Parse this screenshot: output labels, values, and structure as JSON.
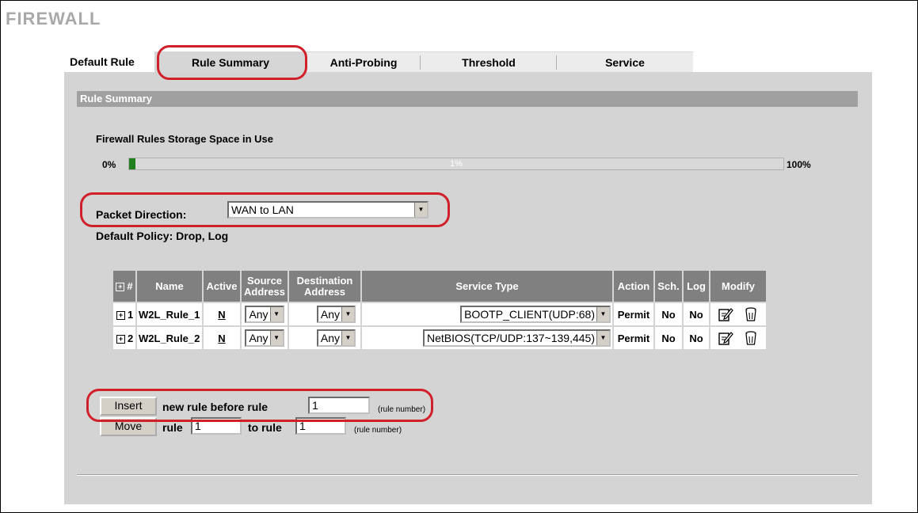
{
  "page": {
    "title": "FIREWALL"
  },
  "tabs": [
    {
      "label": "Default Rule"
    },
    {
      "label": "Rule Summary"
    },
    {
      "label": "Anti-Probing"
    },
    {
      "label": "Threshold"
    },
    {
      "label": "Service"
    }
  ],
  "active_tab": "Rule Summary",
  "section": {
    "title": "Rule Summary"
  },
  "storage": {
    "label": "Firewall Rules Storage Space in Use",
    "min_label": "0%",
    "max_label": "100%",
    "value_label": "1%",
    "fill_fraction": 0.01,
    "fill_color": "#208020"
  },
  "direction": {
    "label": "Packet Direction:",
    "value": "WAN to LAN"
  },
  "policy": {
    "text": "Default Policy: Drop, Log"
  },
  "table": {
    "headers": {
      "num": "#",
      "name": "Name",
      "active": "Active",
      "source_1": "Source",
      "source_2": "Address",
      "dest_1": "Destination",
      "dest_2": "Address",
      "service": "Service Type",
      "action": "Action",
      "sch": "Sch.",
      "log": "Log",
      "modify": "Modify"
    },
    "rows": [
      {
        "num": "1",
        "name": "W2L_Rule_1",
        "active": "N",
        "source": "Any",
        "dest": "Any",
        "service": "BOOTP_CLIENT(UDP:68)",
        "action": "Permit",
        "sch": "No",
        "log": "No"
      },
      {
        "num": "2",
        "name": "W2L_Rule_2",
        "active": "N",
        "source": "Any",
        "dest": "Any",
        "service": "NetBIOS(TCP/UDP:137~139,445)",
        "action": "Permit",
        "sch": "No",
        "log": "No"
      }
    ]
  },
  "insert": {
    "button": "Insert",
    "text": "new rule before rule",
    "value": "1",
    "hint": "(rule number)"
  },
  "move": {
    "button": "Move",
    "rule_label": "rule",
    "rule_value": "1",
    "to_label": "to rule",
    "to_value": "1",
    "hint": "(rule number)"
  },
  "colors": {
    "header_bg": "#808080",
    "section_bar": "#a0a0a0",
    "panel_bg": "#d4d4d4",
    "callout": "#d0202a"
  }
}
